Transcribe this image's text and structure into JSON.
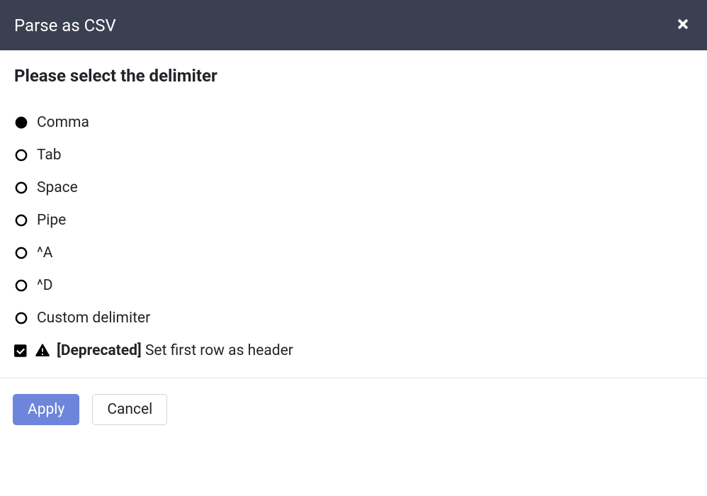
{
  "modal": {
    "title": "Parse as CSV",
    "prompt": "Please select the delimiter",
    "delimiters": [
      {
        "label": "Comma",
        "selected": true
      },
      {
        "label": "Tab",
        "selected": false
      },
      {
        "label": "Space",
        "selected": false
      },
      {
        "label": "Pipe",
        "selected": false
      },
      {
        "label": "^A",
        "selected": false
      },
      {
        "label": "^D",
        "selected": false
      },
      {
        "label": "Custom delimiter",
        "selected": false
      }
    ],
    "header_checkbox": {
      "checked": true,
      "deprecated_tag": "[Deprecated]",
      "label": "Set first row as header"
    },
    "buttons": {
      "apply": "Apply",
      "cancel": "Cancel"
    }
  }
}
